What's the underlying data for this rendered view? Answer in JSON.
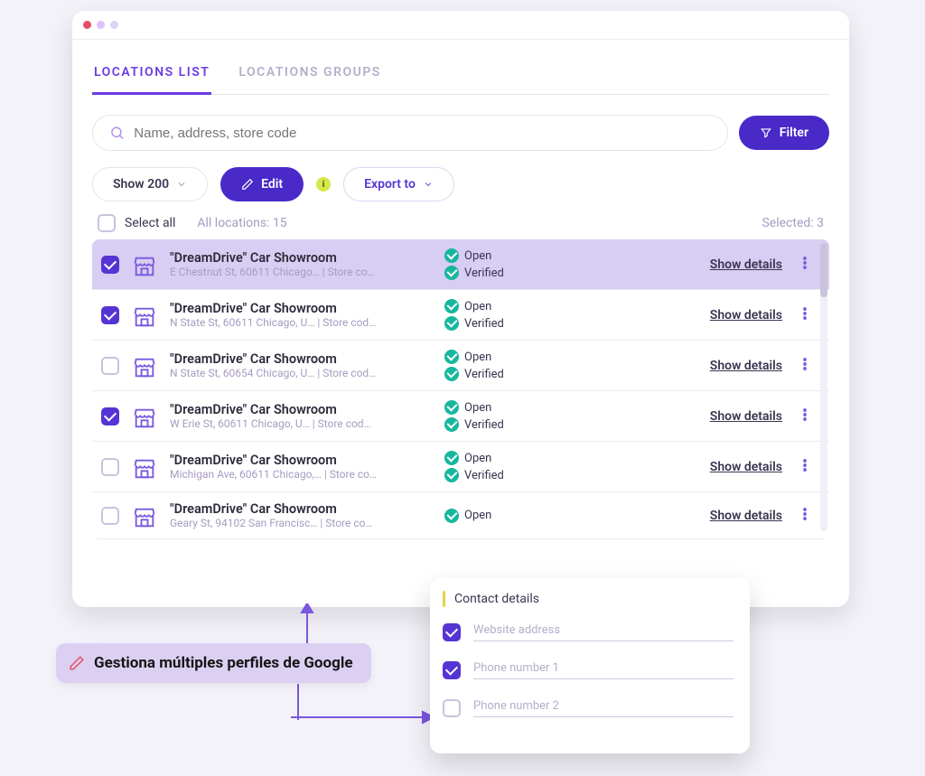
{
  "tabs": {
    "list": "LOCATIONS LIST",
    "groups": "LOCATIONS GROUPS"
  },
  "search": {
    "placeholder": "Name, address, store code"
  },
  "buttons": {
    "filter": "Filter",
    "show": "Show 200",
    "edit": "Edit",
    "export": "Export to"
  },
  "meta": {
    "select_all": "Select all",
    "all_locations": "All locations: 15",
    "selected": "Selected: 3",
    "show_details": "Show details"
  },
  "rows": [
    {
      "title": "\"DreamDrive\" Car Showroom",
      "sub": "E Chestnut St, 60611 Chicago…   |   Store co…",
      "open": "Open",
      "verified": "Verified",
      "checked": true,
      "selected": true
    },
    {
      "title": "\"DreamDrive\" Car Showroom",
      "sub": "N State St, 60611 Chicago, U…   |   Store cod…",
      "open": "Open",
      "verified": "Verified",
      "checked": true,
      "selected": false
    },
    {
      "title": "\"DreamDrive\" Car Showroom",
      "sub": "N State St, 60654 Chicago, U…   |   Store cod…",
      "open": "Open",
      "verified": "Verified",
      "checked": false,
      "selected": false
    },
    {
      "title": "\"DreamDrive\" Car Showroom",
      "sub": "W Erie St, 60611 Chicago, U…   |   Store cod…",
      "open": "Open",
      "verified": "Verified",
      "checked": true,
      "selected": false
    },
    {
      "title": "\"DreamDrive\" Car Showroom",
      "sub": "Michigan Ave, 60611 Chicago,…   |   Store co…",
      "open": "Open",
      "verified": "Verified",
      "checked": false,
      "selected": false
    },
    {
      "title": "\"DreamDrive\" Car Showroom",
      "sub": "Geary St, 94102 San Francisc…   |   Store co…",
      "open": "Open",
      "verified": "",
      "checked": false,
      "selected": false
    }
  ],
  "popup": {
    "title": "Contact details",
    "fields": {
      "website": "Website address",
      "phone1": "Phone number 1",
      "phone2": "Phone number 2"
    },
    "checked": {
      "website": true,
      "phone1": true,
      "phone2": false
    }
  },
  "callout": "Gestiona múltiples perfiles de Google"
}
